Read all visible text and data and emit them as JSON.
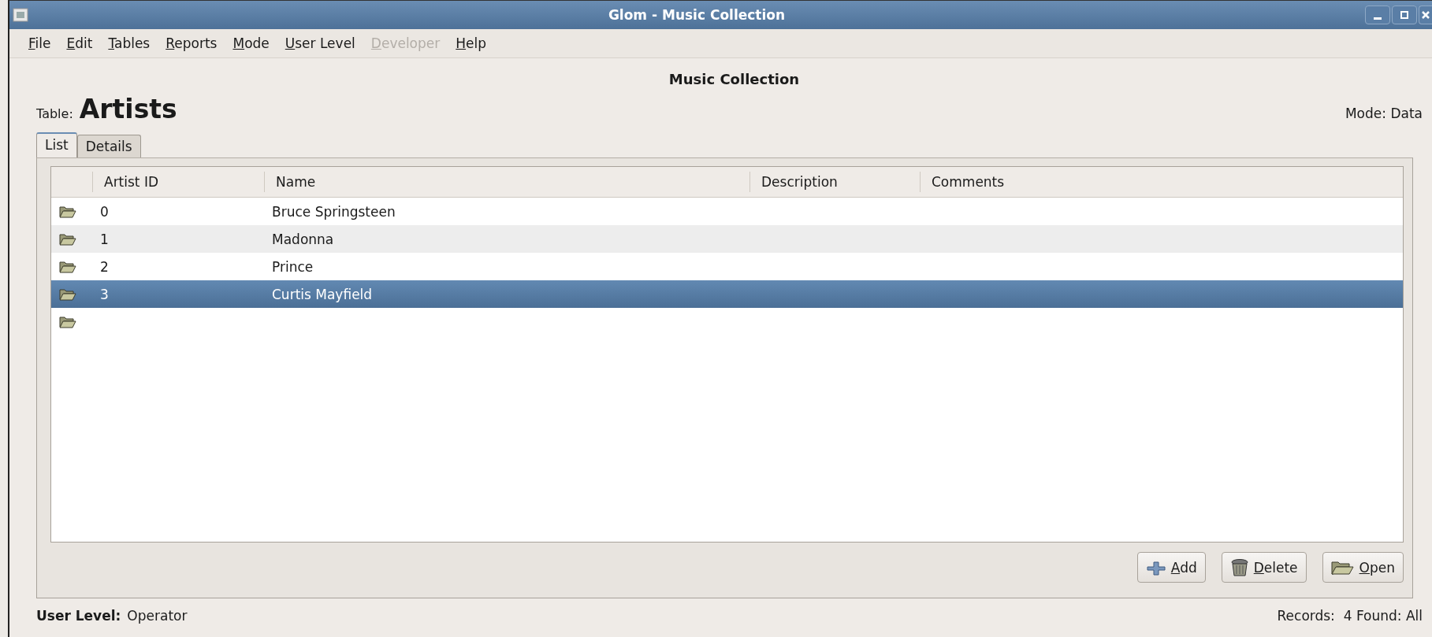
{
  "window": {
    "title": "Glom - Music Collection"
  },
  "menu": [
    {
      "label": "File",
      "disabled": false
    },
    {
      "label": "Edit",
      "disabled": false
    },
    {
      "label": "Tables",
      "disabled": false
    },
    {
      "label": "Reports",
      "disabled": false
    },
    {
      "label": "Mode",
      "disabled": false
    },
    {
      "label": "User Level",
      "disabled": false
    },
    {
      "label": "Developer",
      "disabled": true
    },
    {
      "label": "Help",
      "disabled": false
    }
  ],
  "heading": "Music Collection",
  "table_label": "Table:",
  "table_name": "Artists",
  "mode": "Mode: Data",
  "tabs": [
    {
      "label": "List",
      "selected": true
    },
    {
      "label": "Details",
      "selected": false
    }
  ],
  "list": {
    "columns": [
      "Artist ID",
      "Name",
      "Description",
      "Comments"
    ],
    "rows": [
      {
        "id": "0",
        "name": "Bruce Springsteen",
        "selected": false
      },
      {
        "id": "1",
        "name": "Madonna",
        "selected": false
      },
      {
        "id": "2",
        "name": "Prince",
        "selected": false
      },
      {
        "id": "3",
        "name": "Curtis Mayfield",
        "selected": true
      }
    ],
    "new_row": true
  },
  "buttons": [
    {
      "label": "Add",
      "kind": "add"
    },
    {
      "label": "Delete",
      "kind": "delete"
    },
    {
      "label": "Open",
      "kind": "open"
    }
  ],
  "status": {
    "user_level_label": "User Level:",
    "user_level": "Operator",
    "records": "Records:  4 Found: All"
  }
}
